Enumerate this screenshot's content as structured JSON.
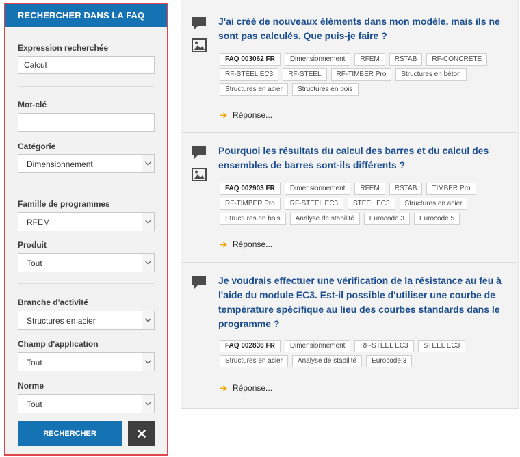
{
  "sidebar": {
    "title": "RECHERCHER DANS LA FAQ",
    "search_label": "Expression recherchée",
    "search_value": "Calcul",
    "keyword_label": "Mot-clé",
    "keyword_value": "",
    "category_label": "Catégorie",
    "category_value": "Dimensionnement",
    "family_label": "Famille de programmes",
    "family_value": "RFEM",
    "product_label": "Produit",
    "product_value": "Tout",
    "industry_label": "Branche d'activité",
    "industry_value": "Structures en acier",
    "field_label": "Champ d'application",
    "field_value": "Tout",
    "norm_label": "Norme",
    "norm_value": "Tout",
    "search_button": "RECHERCHER",
    "clear_button": "✕"
  },
  "results": [
    {
      "title": "J'ai créé de nouveaux éléments dans mon modèle, mais ils ne sont pas calculés. Que puis-je faire ?",
      "id_tag": "FAQ 003062 FR",
      "tags": [
        "Dimensionnement",
        "RFEM",
        "RSTAB",
        "RF-CONCRETE",
        "RF-STEEL EC3",
        "RF-STEEL",
        "RF-TIMBER Pro",
        "Structures en béton",
        "Structures en acier",
        "Structures en bois"
      ],
      "answer": "Réponse..."
    },
    {
      "title": "Pourquoi les résultats du calcul des barres et du calcul des ensembles de barres sont-ils différents ?",
      "id_tag": "FAQ 002903 FR",
      "tags": [
        "Dimensionnement",
        "RFEM",
        "RSTAB",
        "TIMBER Pro",
        "RF-TIMBER Pro",
        "RF-STEEL EC3",
        "STEEL EC3",
        "Structures en acier",
        "Structures en bois",
        "Analyse de stabilité",
        "Eurocode 3",
        "Eurocode 5"
      ],
      "answer": "Réponse..."
    },
    {
      "title": "Je voudrais effectuer une vérification de la résistance au feu à l'aide du module EC3. Est-il possible d'utiliser une courbe de température spécifique au lieu des courbes standards dans le programme ?",
      "id_tag": "FAQ 002836 FR",
      "tags": [
        "Dimensionnement",
        "RF-STEEL EC3",
        "STEEL EC3",
        "Structures en acier",
        "Analyse de stabilité",
        "Eurocode 3"
      ],
      "answer": "Réponse..."
    }
  ],
  "icons": {
    "comment": "comment-icon",
    "image": "image-icon",
    "dropdown": "chevron-down-icon",
    "answer_arrow": "arrow-right-icon",
    "clear": "close-icon"
  },
  "colors": {
    "primary": "#1673b3",
    "title": "#1a4d8f",
    "accent_arrow": "#f0a500",
    "outline": "#e0474c",
    "dark_button": "#3e3e3e"
  }
}
